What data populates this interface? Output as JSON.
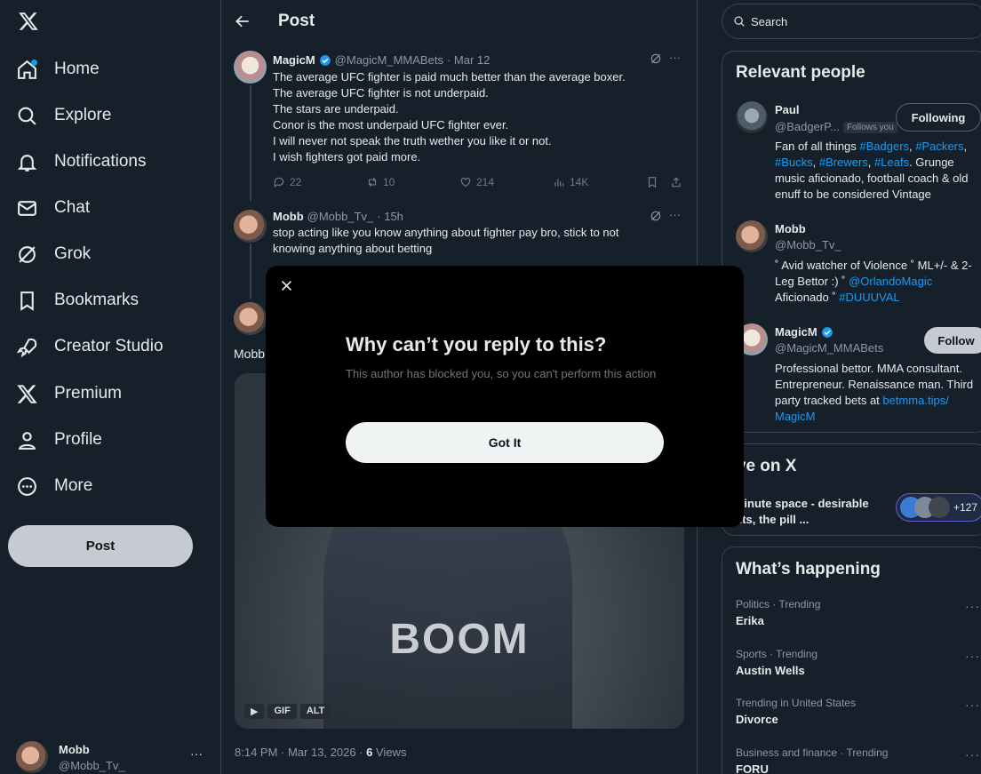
{
  "sidebar": {
    "items": [
      {
        "label": "Home",
        "icon": "home-icon"
      },
      {
        "label": "Explore",
        "icon": "search-icon"
      },
      {
        "label": "Notifications",
        "icon": "bell-icon"
      },
      {
        "label": "Chat",
        "icon": "envelope-icon"
      },
      {
        "label": "Grok",
        "icon": "grok-icon"
      },
      {
        "label": "Bookmarks",
        "icon": "bookmark-icon"
      },
      {
        "label": "Creator Studio",
        "icon": "rocket-icon"
      },
      {
        "label": "Premium",
        "icon": "x-logo-icon"
      },
      {
        "label": "Profile",
        "icon": "person-icon"
      },
      {
        "label": "More",
        "icon": "more-circle-icon"
      }
    ],
    "post_label": "Post",
    "account": {
      "name": "Mobb",
      "handle": "@Mobb_Tv_",
      "more": "···"
    }
  },
  "main": {
    "title": "Post",
    "tweet1": {
      "name": "MagicM",
      "handle": "@MagicM_MMABets",
      "date": "· Mar 12",
      "lines": [
        "The average UFC fighter is paid much better than the average boxer.",
        "The average UFC fighter is not underpaid.",
        "The stars are underpaid.",
        "Conor is the most underpaid UFC fighter ever.",
        "I will never not speak the truth wether you like it or not.",
        "I wish fighters got paid more."
      ],
      "replies": "22",
      "reposts": "10",
      "likes": "214",
      "views": "14K",
      "more": "···"
    },
    "tweet2": {
      "name": "Mobb",
      "handle": "@Mobb_Tv_",
      "date": "· 15h",
      "text": "stop acting like you know anything about fighter pay bro, stick to not knowing anything about betting",
      "more": "···"
    },
    "tweet3": {
      "name_partial": "Mobb",
      "gif_text": "BOOM",
      "badge_gif": "GIF",
      "badge_alt": "ALT",
      "footer_time": "8:14 PM · Mar 13, 2026 ·",
      "footer_views_count": "6",
      "footer_views_label": "Views"
    }
  },
  "right": {
    "search_placeholder": "Search",
    "relevant": {
      "title": "Relevant people",
      "people": [
        {
          "name": "Paul",
          "handle": "@BadgerP...",
          "follows_you": "Follows you",
          "button": "Following",
          "bio_pre": "Fan of all things ",
          "bio_tags": [
            "#Badgers",
            "#Packers",
            "#Bucks",
            "#Brewers",
            "#Leafs"
          ],
          "bio_post": ". Grunge music aficionado, football coach & old enuff to be considered Vintage"
        },
        {
          "name": "Mobb",
          "handle": "@Mobb_Tv_",
          "bio_pre": "˚ Avid watcher of Violence ˚ ML+/- & 2-Leg Bettor :) ˚ ",
          "bio_link1": "@OrlandoMagic",
          "bio_mid": " Aficionado ˚ ",
          "bio_link2": "#DUUUVAL"
        },
        {
          "name": "MagicM",
          "handle": "@MagicM_MMABets",
          "button": "Follow",
          "bio_pre": "Professional bettor. MMA consultant. Entrepreneur. Renaissance man. Third party tracked bets at ",
          "bio_link": "betmma.tips/ MagicM"
        }
      ]
    },
    "live": {
      "title": "Live on X",
      "space_title": "5 minute space - desirable traits, the pill ...",
      "count": "+127"
    },
    "happening": {
      "title": "What’s happening",
      "trends": [
        {
          "category": "Politics · Trending",
          "name": "Erika"
        },
        {
          "category": "Sports · Trending",
          "name": "Austin Wells"
        },
        {
          "category": "Trending in United States",
          "name": "Divorce"
        },
        {
          "category": "Business and finance · Trending",
          "name": "FORU"
        }
      ]
    }
  },
  "modal": {
    "title": "Why can’t you reply to this?",
    "text": "This author has blocked you, so you can't perform this action",
    "button": "Got It"
  },
  "colors": {
    "accent": "#1d9bf0",
    "background": "#15202b",
    "border": "#38444d",
    "modal_bg": "#000000"
  }
}
